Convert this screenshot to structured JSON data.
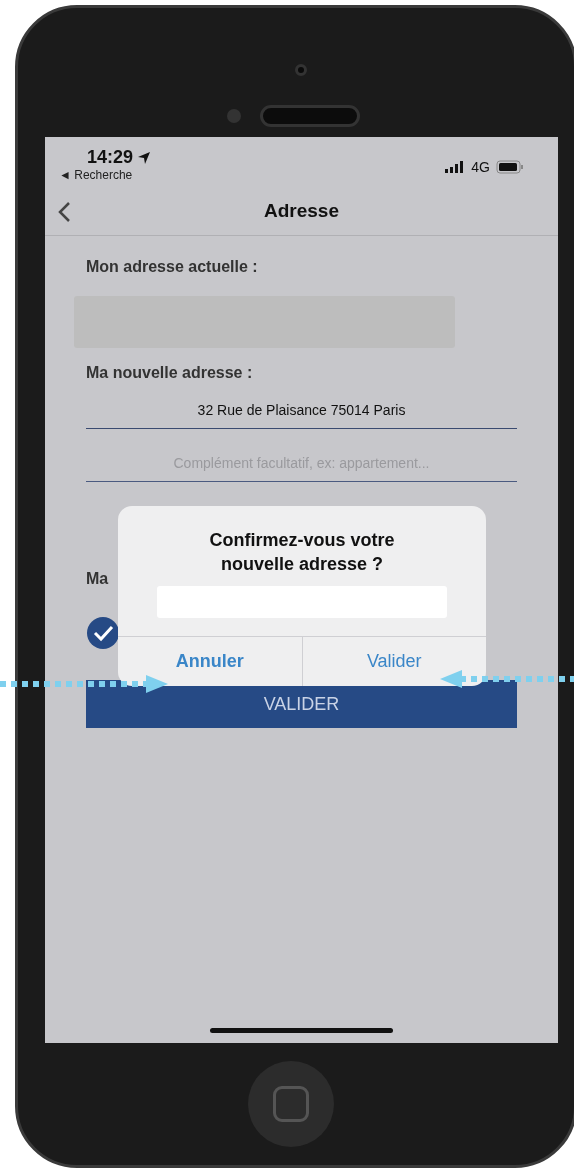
{
  "status_bar": {
    "time": "14:29",
    "back_app": "◄ Recherche",
    "network": "4G"
  },
  "nav": {
    "title": "Adresse"
  },
  "current_address": {
    "label": "Mon adresse actuelle :"
  },
  "new_address": {
    "label": "Ma nouvelle adresse :",
    "value": "32 Rue de Plaisance 75014 Paris"
  },
  "complement": {
    "placeholder": "Complément facultatif, ex: appartement..."
  },
  "option": {
    "label": "Ma",
    "checked": true
  },
  "submit": "VALIDER",
  "dialog": {
    "title": "Confirmez-vous votre nouvelle adresse ?",
    "buttons": [
      {
        "label": "Annuler",
        "kind": "cancel"
      },
      {
        "label": "Valider",
        "kind": "confirm"
      }
    ]
  }
}
